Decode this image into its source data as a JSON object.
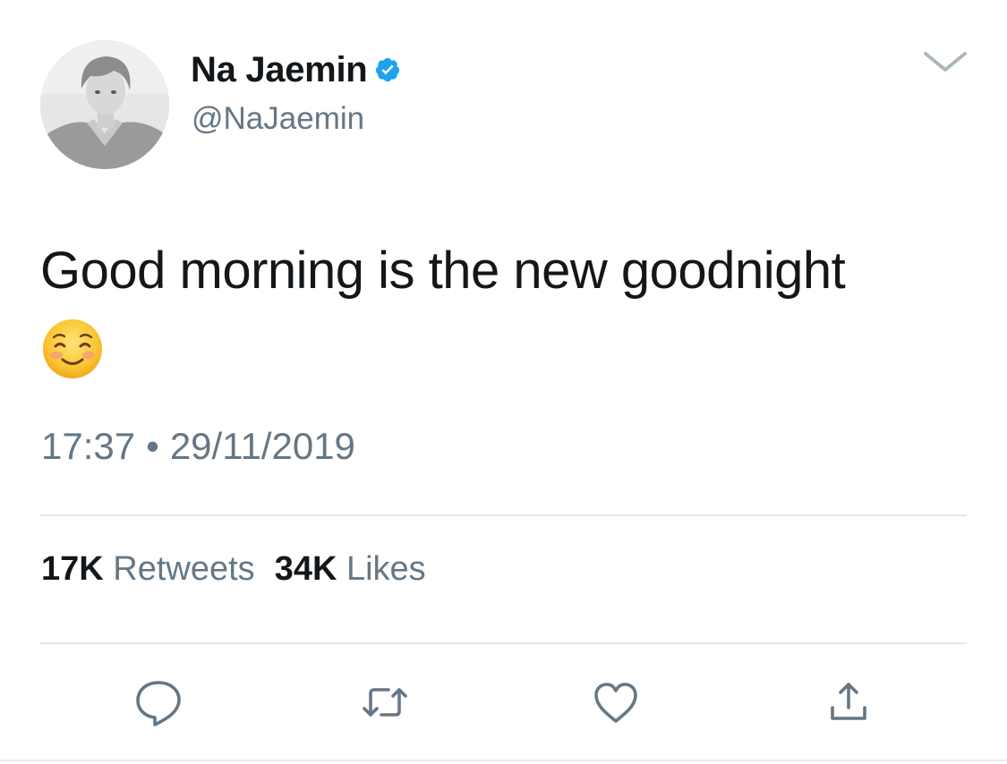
{
  "tweet": {
    "author": {
      "display_name": "Na Jaemin",
      "handle": "@NaJaemin",
      "verified": true
    },
    "text": "Good morning is the new goodnight",
    "emoji": "smiling-face-with-smiling-eyes",
    "time": "17:37",
    "separator": "•",
    "date": "29/11/2019",
    "stats": {
      "retweets_count": "17K",
      "retweets_label": "Retweets",
      "likes_count": "34K",
      "likes_label": "Likes"
    },
    "actions": [
      "reply-icon",
      "retweet-icon",
      "like-icon",
      "share-icon"
    ]
  },
  "colors": {
    "text_primary": "#14171a",
    "text_secondary": "#657786",
    "divider": "#e1e8ed",
    "verified_blue": "#1da1f2",
    "icon_gray": "#657786"
  }
}
